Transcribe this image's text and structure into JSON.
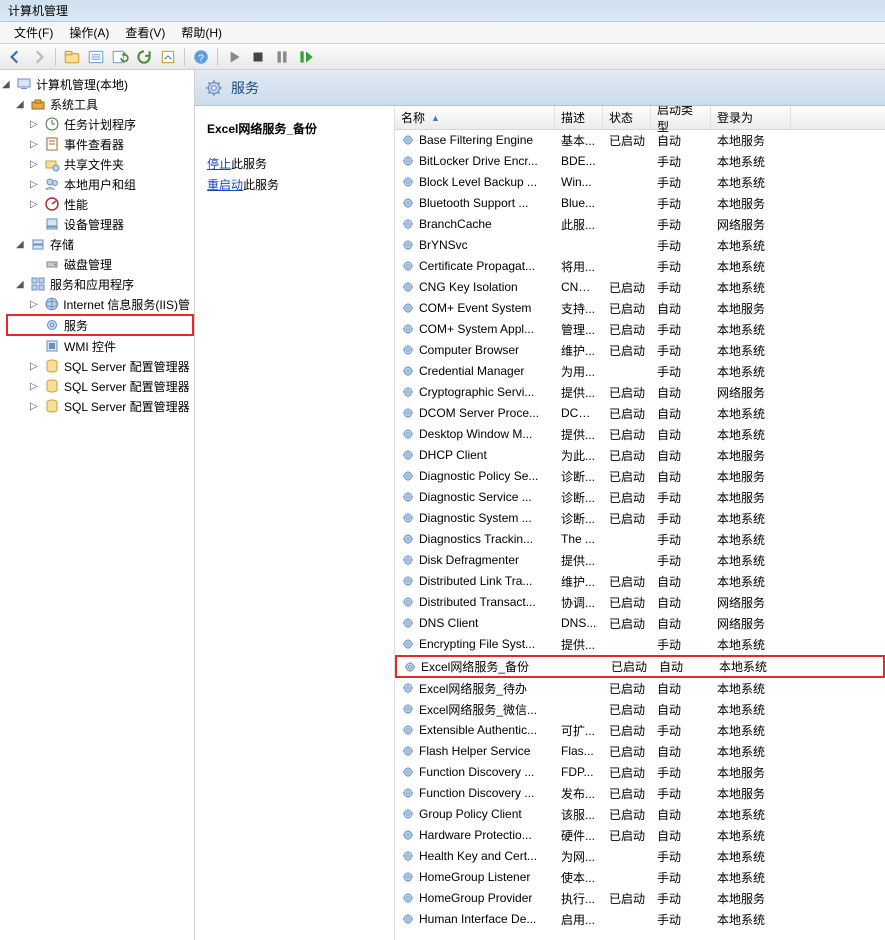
{
  "window": {
    "title": "计算机管理"
  },
  "menus": [
    "文件(F)",
    "操作(A)",
    "查看(V)",
    "帮助(H)"
  ],
  "tree": {
    "root": "计算机管理(本地)",
    "sections": [
      {
        "label": "系统工具",
        "icon": "toolbox",
        "expanded": true,
        "children": [
          {
            "label": "任务计划程序",
            "icon": "clock",
            "expandable": true
          },
          {
            "label": "事件查看器",
            "icon": "event",
            "expandable": true
          },
          {
            "label": "共享文件夹",
            "icon": "share",
            "expandable": true
          },
          {
            "label": "本地用户和组",
            "icon": "users",
            "expandable": true
          },
          {
            "label": "性能",
            "icon": "perf",
            "expandable": true
          },
          {
            "label": "设备管理器",
            "icon": "device",
            "expandable": false
          }
        ]
      },
      {
        "label": "存储",
        "icon": "storage",
        "expanded": true,
        "children": [
          {
            "label": "磁盘管理",
            "icon": "disk",
            "expandable": false
          }
        ]
      },
      {
        "label": "服务和应用程序",
        "icon": "apps",
        "expanded": true,
        "children": [
          {
            "label": "Internet 信息服务(IIS)管",
            "icon": "iis",
            "expandable": true
          },
          {
            "label": "服务",
            "icon": "gear",
            "expandable": false,
            "highlighted": true
          },
          {
            "label": "WMI 控件",
            "icon": "wmi",
            "expandable": false
          },
          {
            "label": "SQL Server 配置管理器",
            "icon": "sql",
            "expandable": true
          },
          {
            "label": "SQL Server 配置管理器",
            "icon": "sql",
            "expandable": true
          },
          {
            "label": "SQL Server 配置管理器",
            "icon": "sql",
            "expandable": true
          }
        ]
      }
    ]
  },
  "header_title": "服务",
  "detail": {
    "service_name": "Excel网络服务_备份",
    "stop_link": "停止",
    "stop_suffix": "此服务",
    "restart_link": "重启动",
    "restart_suffix": "此服务"
  },
  "columns": {
    "name": "名称",
    "desc": "描述",
    "status": "状态",
    "start": "启动类型",
    "logon": "登录为"
  },
  "services": [
    {
      "name": "Base Filtering Engine",
      "desc": "基本...",
      "status": "已启动",
      "start": "自动",
      "logon": "本地服务"
    },
    {
      "name": "BitLocker Drive Encr...",
      "desc": "BDE...",
      "status": "",
      "start": "手动",
      "logon": "本地系统"
    },
    {
      "name": "Block Level Backup ...",
      "desc": "Win...",
      "status": "",
      "start": "手动",
      "logon": "本地系统"
    },
    {
      "name": "Bluetooth Support ...",
      "desc": "Blue...",
      "status": "",
      "start": "手动",
      "logon": "本地服务"
    },
    {
      "name": "BranchCache",
      "desc": "此服...",
      "status": "",
      "start": "手动",
      "logon": "网络服务"
    },
    {
      "name": "BrYNSvc",
      "desc": "",
      "status": "",
      "start": "手动",
      "logon": "本地系统"
    },
    {
      "name": "Certificate Propagat...",
      "desc": "将用...",
      "status": "",
      "start": "手动",
      "logon": "本地系统"
    },
    {
      "name": "CNG Key Isolation",
      "desc": "CNG...",
      "status": "已启动",
      "start": "手动",
      "logon": "本地系统"
    },
    {
      "name": "COM+ Event System",
      "desc": "支持...",
      "status": "已启动",
      "start": "自动",
      "logon": "本地服务"
    },
    {
      "name": "COM+ System Appl...",
      "desc": "管理...",
      "status": "已启动",
      "start": "手动",
      "logon": "本地系统"
    },
    {
      "name": "Computer Browser",
      "desc": "维护...",
      "status": "已启动",
      "start": "手动",
      "logon": "本地系统"
    },
    {
      "name": "Credential Manager",
      "desc": "为用...",
      "status": "",
      "start": "手动",
      "logon": "本地系统"
    },
    {
      "name": "Cryptographic Servi...",
      "desc": "提供...",
      "status": "已启动",
      "start": "自动",
      "logon": "网络服务"
    },
    {
      "name": "DCOM Server Proce...",
      "desc": "DCO...",
      "status": "已启动",
      "start": "自动",
      "logon": "本地系统"
    },
    {
      "name": "Desktop Window M...",
      "desc": "提供...",
      "status": "已启动",
      "start": "自动",
      "logon": "本地系统"
    },
    {
      "name": "DHCP Client",
      "desc": "为此...",
      "status": "已启动",
      "start": "自动",
      "logon": "本地服务"
    },
    {
      "name": "Diagnostic Policy Se...",
      "desc": "诊断...",
      "status": "已启动",
      "start": "自动",
      "logon": "本地服务"
    },
    {
      "name": "Diagnostic Service ...",
      "desc": "诊断...",
      "status": "已启动",
      "start": "手动",
      "logon": "本地服务"
    },
    {
      "name": "Diagnostic System ...",
      "desc": "诊断...",
      "status": "已启动",
      "start": "手动",
      "logon": "本地系统"
    },
    {
      "name": "Diagnostics Trackin...",
      "desc": "The ...",
      "status": "",
      "start": "手动",
      "logon": "本地系统"
    },
    {
      "name": "Disk Defragmenter",
      "desc": "提供...",
      "status": "",
      "start": "手动",
      "logon": "本地系统"
    },
    {
      "name": "Distributed Link Tra...",
      "desc": "维护...",
      "status": "已启动",
      "start": "自动",
      "logon": "本地系统"
    },
    {
      "name": "Distributed Transact...",
      "desc": "协调...",
      "status": "已启动",
      "start": "自动",
      "logon": "网络服务"
    },
    {
      "name": "DNS Client",
      "desc": "DNS...",
      "status": "已启动",
      "start": "自动",
      "logon": "网络服务"
    },
    {
      "name": "Encrypting File Syst...",
      "desc": "提供...",
      "status": "",
      "start": "手动",
      "logon": "本地系统"
    },
    {
      "name": "Excel网络服务_备份",
      "desc": "",
      "status": "已启动",
      "start": "自动",
      "logon": "本地系统",
      "highlighted": true
    },
    {
      "name": "Excel网络服务_待办",
      "desc": "",
      "status": "已启动",
      "start": "自动",
      "logon": "本地系统"
    },
    {
      "name": "Excel网络服务_微信...",
      "desc": "",
      "status": "已启动",
      "start": "自动",
      "logon": "本地系统"
    },
    {
      "name": "Extensible Authentic...",
      "desc": "可扩...",
      "status": "已启动",
      "start": "手动",
      "logon": "本地系统"
    },
    {
      "name": "Flash Helper Service",
      "desc": "Flas...",
      "status": "已启动",
      "start": "自动",
      "logon": "本地系统"
    },
    {
      "name": "Function Discovery ...",
      "desc": "FDP...",
      "status": "已启动",
      "start": "手动",
      "logon": "本地服务"
    },
    {
      "name": "Function Discovery ...",
      "desc": "发布...",
      "status": "已启动",
      "start": "手动",
      "logon": "本地服务"
    },
    {
      "name": "Group Policy Client",
      "desc": "该服...",
      "status": "已启动",
      "start": "自动",
      "logon": "本地系统"
    },
    {
      "name": "Hardware Protectio...",
      "desc": "硬件...",
      "status": "已启动",
      "start": "自动",
      "logon": "本地系统"
    },
    {
      "name": "Health Key and Cert...",
      "desc": "为网...",
      "status": "",
      "start": "手动",
      "logon": "本地系统"
    },
    {
      "name": "HomeGroup Listener",
      "desc": "使本...",
      "status": "",
      "start": "手动",
      "logon": "本地系统"
    },
    {
      "name": "HomeGroup Provider",
      "desc": "执行...",
      "status": "已启动",
      "start": "手动",
      "logon": "本地服务"
    },
    {
      "name": "Human Interface De...",
      "desc": "启用...",
      "status": "",
      "start": "手动",
      "logon": "本地系统"
    }
  ]
}
